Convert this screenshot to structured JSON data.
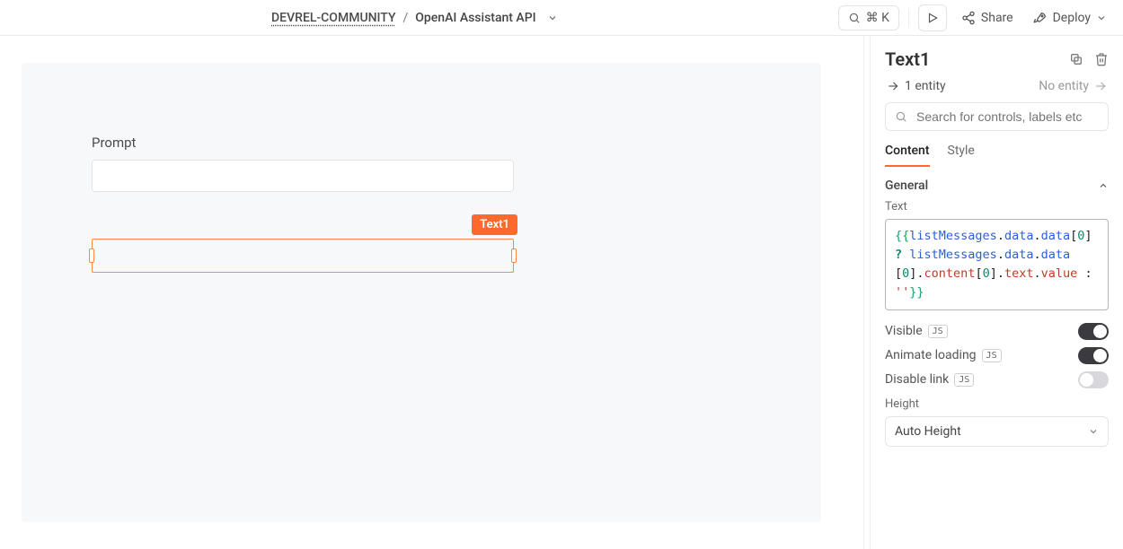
{
  "topbar": {
    "workspace": "DEVREL-COMMUNITY",
    "separator": "/",
    "app_name": "OpenAI Assistant API",
    "search_kbd": "⌘ K",
    "share_label": "Share",
    "deploy_label": "Deploy"
  },
  "canvas": {
    "prompt_label": "Prompt",
    "selected_widget_label": "Text1"
  },
  "sidebar": {
    "title": "Text1",
    "entity_count": "1 entity",
    "no_entity": "No entity",
    "search_placeholder": "Search for controls, labels etc",
    "tabs": {
      "content": "Content",
      "style": "Style"
    },
    "section_general": "General",
    "text_label": "Text",
    "code_tokens": {
      "open": "{{",
      "id1": "listMessages",
      "data": "data",
      "idx0": "0",
      "q": "?",
      "content": "content",
      "text": "text",
      "value": "value",
      "colon": ":",
      "empty": "''",
      "close": "}}"
    },
    "visible_label": "Visible",
    "animate_label": "Animate loading",
    "disable_link_label": "Disable link",
    "js_badge": "JS",
    "height_label": "Height",
    "height_value": "Auto Height",
    "toggles": {
      "visible": "on",
      "animate": "on",
      "disable_link": "off"
    }
  }
}
